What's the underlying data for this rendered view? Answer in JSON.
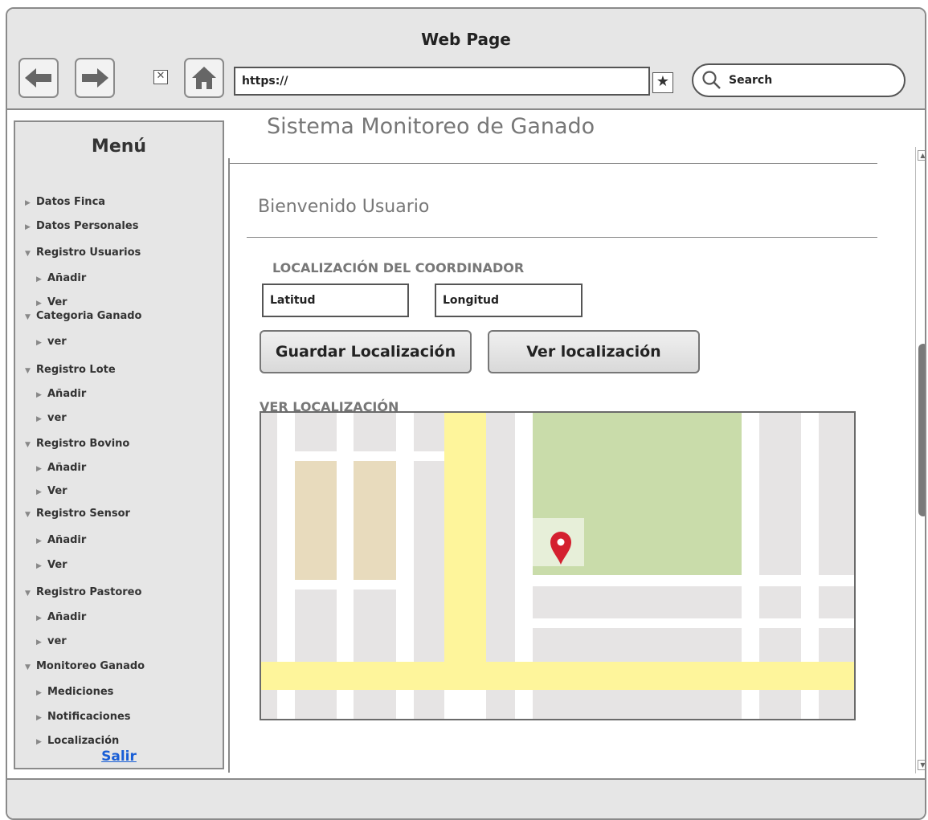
{
  "browser": {
    "title": "Web Page",
    "url": "https://",
    "search_label": "Search"
  },
  "sidebar": {
    "title": "Menú",
    "items": [
      {
        "label": "Datos Finca",
        "level": 0,
        "expanded": false
      },
      {
        "label": "Datos Personales",
        "level": 0,
        "expanded": false
      },
      {
        "label": "Registro Usuarios",
        "level": 0,
        "expanded": true
      },
      {
        "label": "Añadir",
        "level": 1
      },
      {
        "label": "Ver",
        "level": 1
      },
      {
        "label": "Categoria Ganado",
        "level": 0,
        "expanded": true
      },
      {
        "label": "ver",
        "level": 1
      },
      {
        "label": "Registro Lote",
        "level": 0,
        "expanded": true
      },
      {
        "label": "Añadir",
        "level": 1
      },
      {
        "label": "ver",
        "level": 1
      },
      {
        "label": "Registro Bovino",
        "level": 0,
        "expanded": true
      },
      {
        "label": "Añadir",
        "level": 1
      },
      {
        "label": "Ver",
        "level": 1
      },
      {
        "label": "Registro Sensor",
        "level": 0,
        "expanded": true
      },
      {
        "label": "Añadir",
        "level": 1
      },
      {
        "label": "Ver",
        "level": 1
      },
      {
        "label": "Registro Pastoreo",
        "level": 0,
        "expanded": true
      },
      {
        "label": "Añadir",
        "level": 1
      },
      {
        "label": "ver",
        "level": 1
      },
      {
        "label": "Monitoreo Ganado",
        "level": 0,
        "expanded": true
      },
      {
        "label": "Mediciones",
        "level": 1
      },
      {
        "label": "Notificaciones",
        "level": 1
      },
      {
        "label": "Localización",
        "level": 1
      }
    ],
    "logout": "Salir"
  },
  "main": {
    "page_title": "Sistema Monitoreo de Ganado",
    "welcome": "Bienvenido Usuario",
    "location_section": "LOCALIZACIÓN DEL COORDINADOR",
    "latitude_value": "Latitud",
    "longitude_value": "Longitud",
    "save_button": "Guardar Localización",
    "view_button": "Ver localización",
    "map_section": "VER LOCALIZACIÓN"
  },
  "colors": {
    "map_road_major": "#fef59b",
    "map_park": "#c9dcaa",
    "map_block": "#e6e4e4",
    "map_building": "#e8dbbd",
    "map_pin": "#d4202f",
    "link": "#1a5fd6"
  }
}
